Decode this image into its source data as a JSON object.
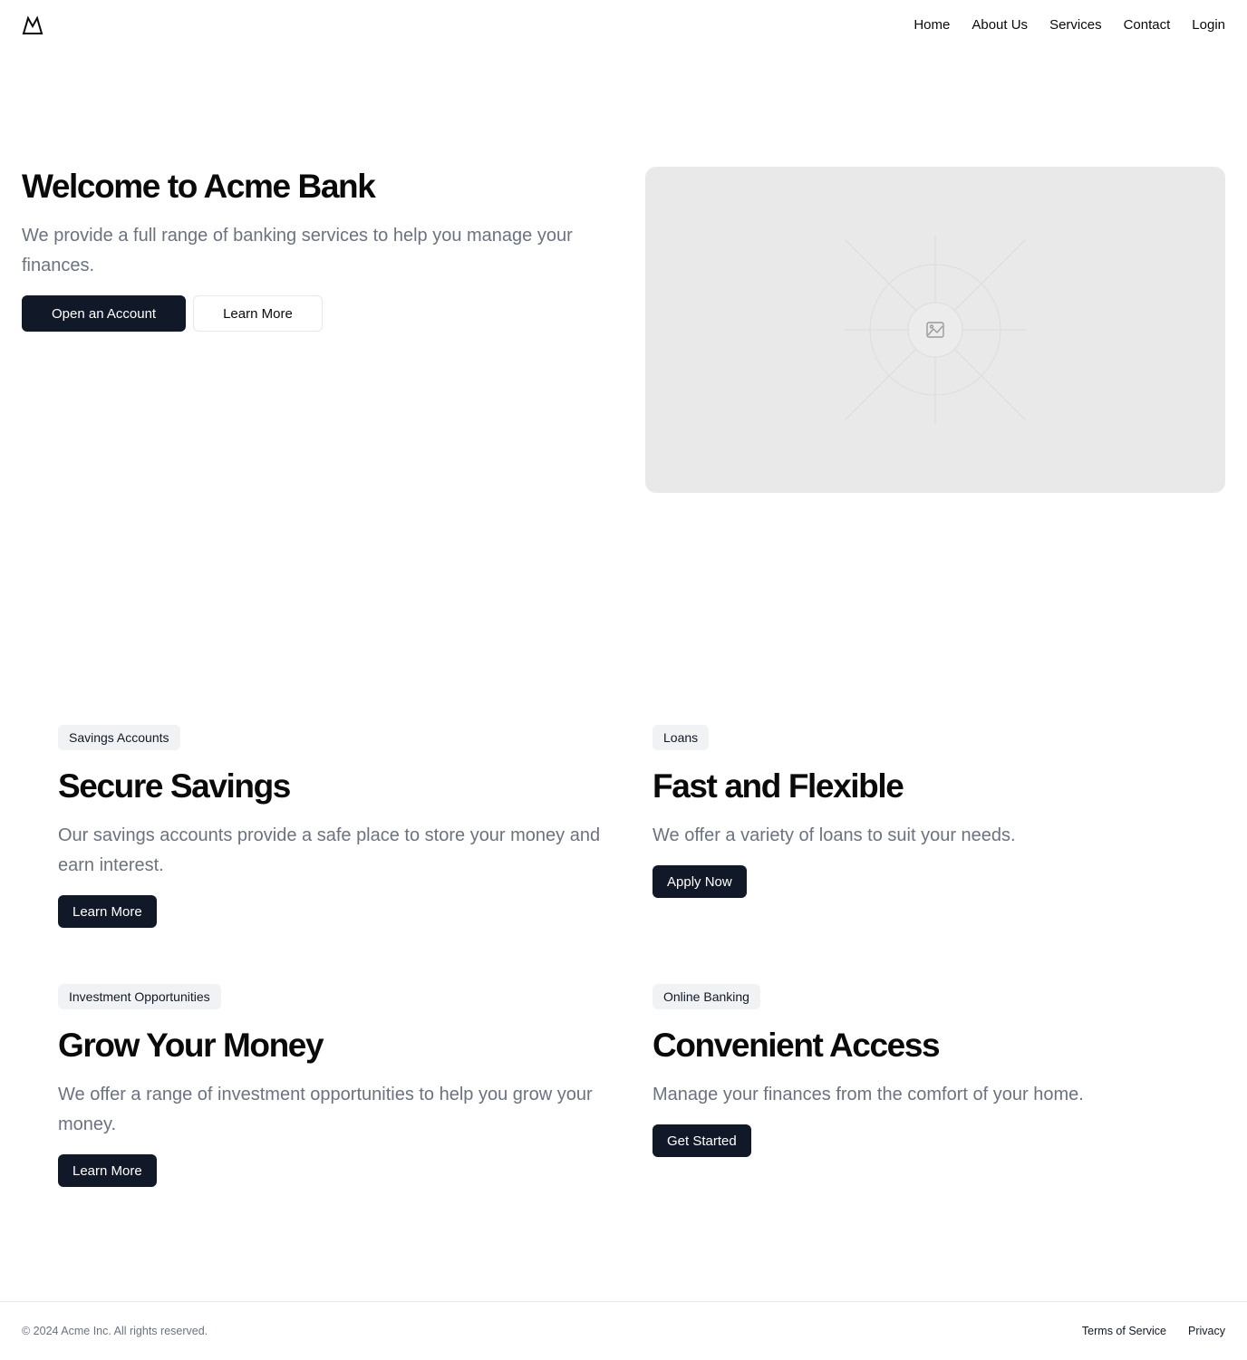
{
  "nav": {
    "home": "Home",
    "about": "About Us",
    "services": "Services",
    "contact": "Contact",
    "login": "Login"
  },
  "hero": {
    "title": "Welcome to Acme Bank",
    "description": "We provide a full range of banking services to help you manage your finances.",
    "primary_button": "Open an Account",
    "secondary_button": "Learn More",
    "image_icon": "image-placeholder-icon"
  },
  "features": [
    {
      "badge": "Savings Accounts",
      "title": "Secure Savings",
      "description": "Our savings accounts provide a safe place to store your money and earn interest.",
      "button": "Learn More"
    },
    {
      "badge": "Loans",
      "title": "Fast and Flexible",
      "description": "We offer a variety of loans to suit your needs.",
      "button": "Apply Now"
    },
    {
      "badge": "Investment Opportunities",
      "title": "Grow Your Money",
      "description": "We offer a range of investment opportunities to help you grow your money.",
      "button": "Learn More"
    },
    {
      "badge": "Online Banking",
      "title": "Convenient Access",
      "description": "Manage your finances from the comfort of your home.",
      "button": "Get Started"
    }
  ],
  "footer": {
    "copyright": "© 2024 Acme Inc. All rights reserved.",
    "terms": "Terms of Service",
    "privacy": "Privacy"
  },
  "colors": {
    "primary": "#111827",
    "muted_text": "#6b7280",
    "badge_bg": "#f1f2f4",
    "placeholder_bg": "#e9e9e9"
  }
}
